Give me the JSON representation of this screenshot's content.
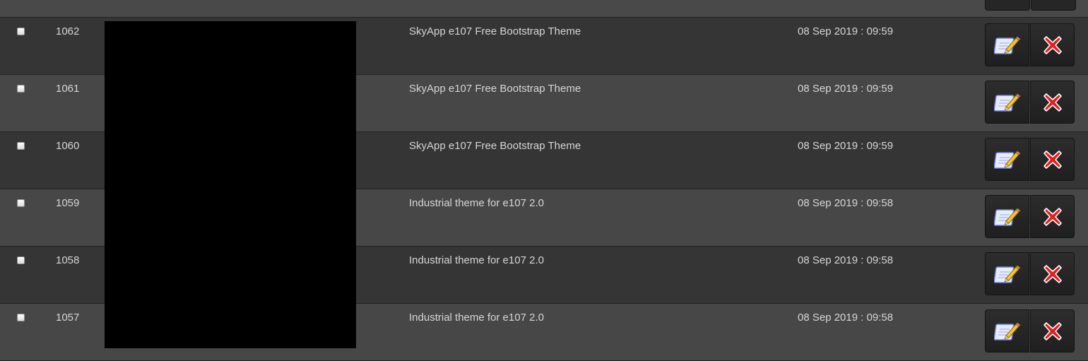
{
  "rows": [
    {
      "id": "1062",
      "title": "SkyApp e107 Free Bootstrap Theme",
      "date": "08 Sep 2019 : 09:59"
    },
    {
      "id": "1061",
      "title": "SkyApp e107 Free Bootstrap Theme",
      "date": "08 Sep 2019 : 09:59"
    },
    {
      "id": "1060",
      "title": "SkyApp e107 Free Bootstrap Theme",
      "date": "08 Sep 2019 : 09:59"
    },
    {
      "id": "1059",
      "title": "Industrial theme for e107 2.0",
      "date": "08 Sep 2019 : 09:58"
    },
    {
      "id": "1058",
      "title": "Industrial theme for e107 2.0",
      "date": "08 Sep 2019 : 09:58"
    },
    {
      "id": "1057",
      "title": "Industrial theme for e107 2.0",
      "date": "08 Sep 2019 : 09:58"
    }
  ],
  "icons": {
    "edit": "edit-pencil-icon",
    "delete": "delete-x-icon"
  },
  "colors": {
    "row_dark": "#353535",
    "row_light": "#474747",
    "delete_red": "#e02020",
    "edit_blue": "#6f7fd6"
  }
}
